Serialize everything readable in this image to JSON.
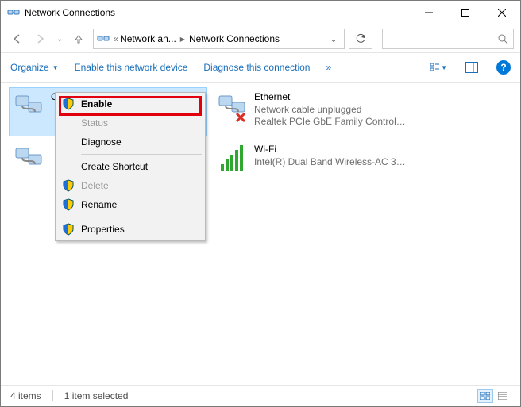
{
  "window": {
    "title": "Network Connections"
  },
  "breadcrumb": {
    "seg1": "Network an...",
    "seg2": "Network Connections"
  },
  "commands": {
    "organize": "Organize",
    "enable": "Enable this network device",
    "diagnose": "Diagnose this connection",
    "more": "»"
  },
  "connections": [
    {
      "name": "Cisco AnyConnect Secure Mobility",
      "desc1": "",
      "desc2": ""
    },
    {
      "name": "",
      "desc1": "",
      "desc2": ""
    },
    {
      "name": "Ethernet",
      "desc1": "Network cable unplugged",
      "desc2": "Realtek PCIe GbE Family Controller"
    },
    {
      "name": "Wi-Fi",
      "desc1": "",
      "desc2": "Intel(R) Dual Band Wireless-AC 31..."
    }
  ],
  "context_menu": {
    "enable": "Enable",
    "status": "Status",
    "diagnose": "Diagnose",
    "create_shortcut": "Create Shortcut",
    "delete": "Delete",
    "rename": "Rename",
    "properties": "Properties"
  },
  "status": {
    "items": "4 items",
    "selected": "1 item selected"
  }
}
